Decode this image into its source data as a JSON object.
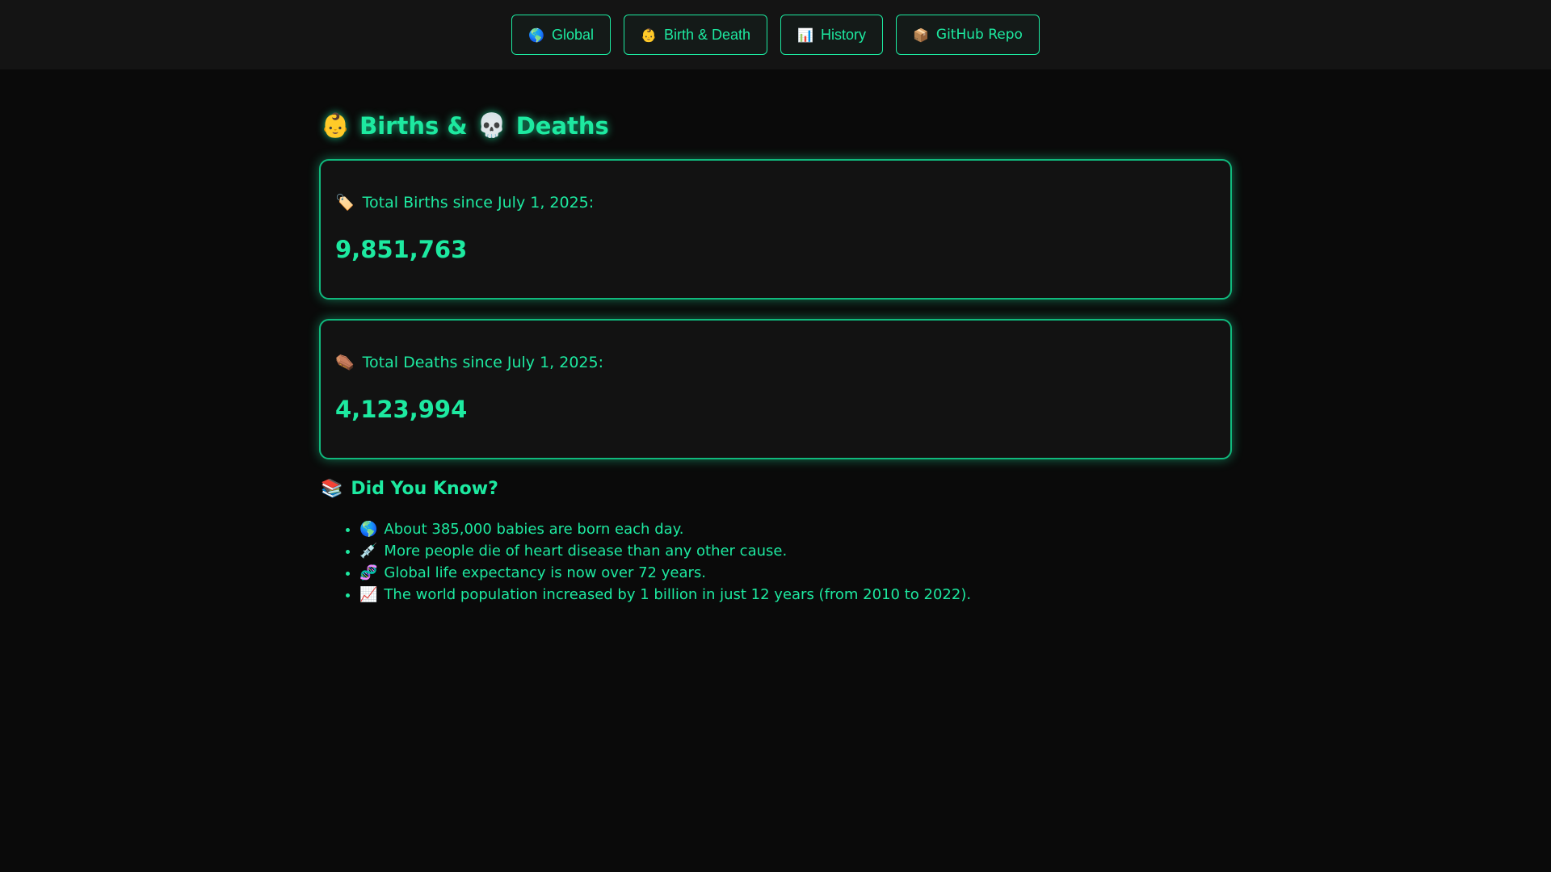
{
  "nav": {
    "global": {
      "icon": "🌎",
      "label": "Global"
    },
    "birth_death": {
      "icon": "👶",
      "label": "Birth & Death"
    },
    "history": {
      "icon": "📊",
      "label": "History"
    },
    "github": {
      "icon": "📦",
      "label": "GitHub Repo"
    }
  },
  "page": {
    "title_icon_births": "👶",
    "title_births": "Births &",
    "title_icon_deaths": "💀",
    "title_deaths": "Deaths"
  },
  "births": {
    "icon": "🏷️",
    "label": "Total Births since July 1, 2025:",
    "value": "9,851,763"
  },
  "deaths": {
    "icon": "⚰️",
    "label": "Total Deaths since July 1, 2025:",
    "value": "4,123,994"
  },
  "did_you_know": {
    "icon": "📚",
    "title": "Did You Know?",
    "facts": [
      {
        "icon": "🌎",
        "text": "About 385,000 babies are born each day."
      },
      {
        "icon": "💉",
        "text": "More people die of heart disease than any other cause."
      },
      {
        "icon": "🧬",
        "text": "Global life expectancy is now over 72 years."
      },
      {
        "icon": "📈",
        "text": "The world population increased by 1 billion in just 12 years (from 2010 to 2022)."
      }
    ]
  },
  "colors": {
    "background": "#0a0a0a",
    "navbar": "#141414",
    "accent": "#1de9a0",
    "card": "#121212"
  }
}
